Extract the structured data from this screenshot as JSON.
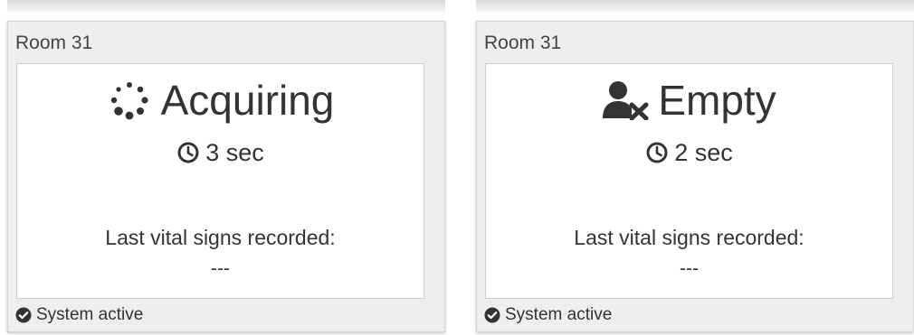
{
  "cards": [
    {
      "room_label": "Room 31",
      "status_icon": "spinner-icon",
      "status_label": "Acquiring",
      "timer_icon": "clock-icon",
      "elapsed": "3 sec",
      "vitals_label": "Last vital signs recorded:",
      "vitals_value": "---",
      "footer_icon": "check-circle-icon",
      "footer_text": "System active"
    },
    {
      "room_label": "Room 31",
      "status_icon": "user-times-icon",
      "status_label": "Empty",
      "timer_icon": "clock-icon",
      "elapsed": "2 sec",
      "vitals_label": "Last vital signs recorded:",
      "vitals_value": "---",
      "footer_icon": "check-circle-icon",
      "footer_text": "System active"
    }
  ],
  "colors": {
    "card_background": "#eeeeee",
    "panel_background": "#ffffff",
    "text": "#333333",
    "icon": "#333333"
  }
}
